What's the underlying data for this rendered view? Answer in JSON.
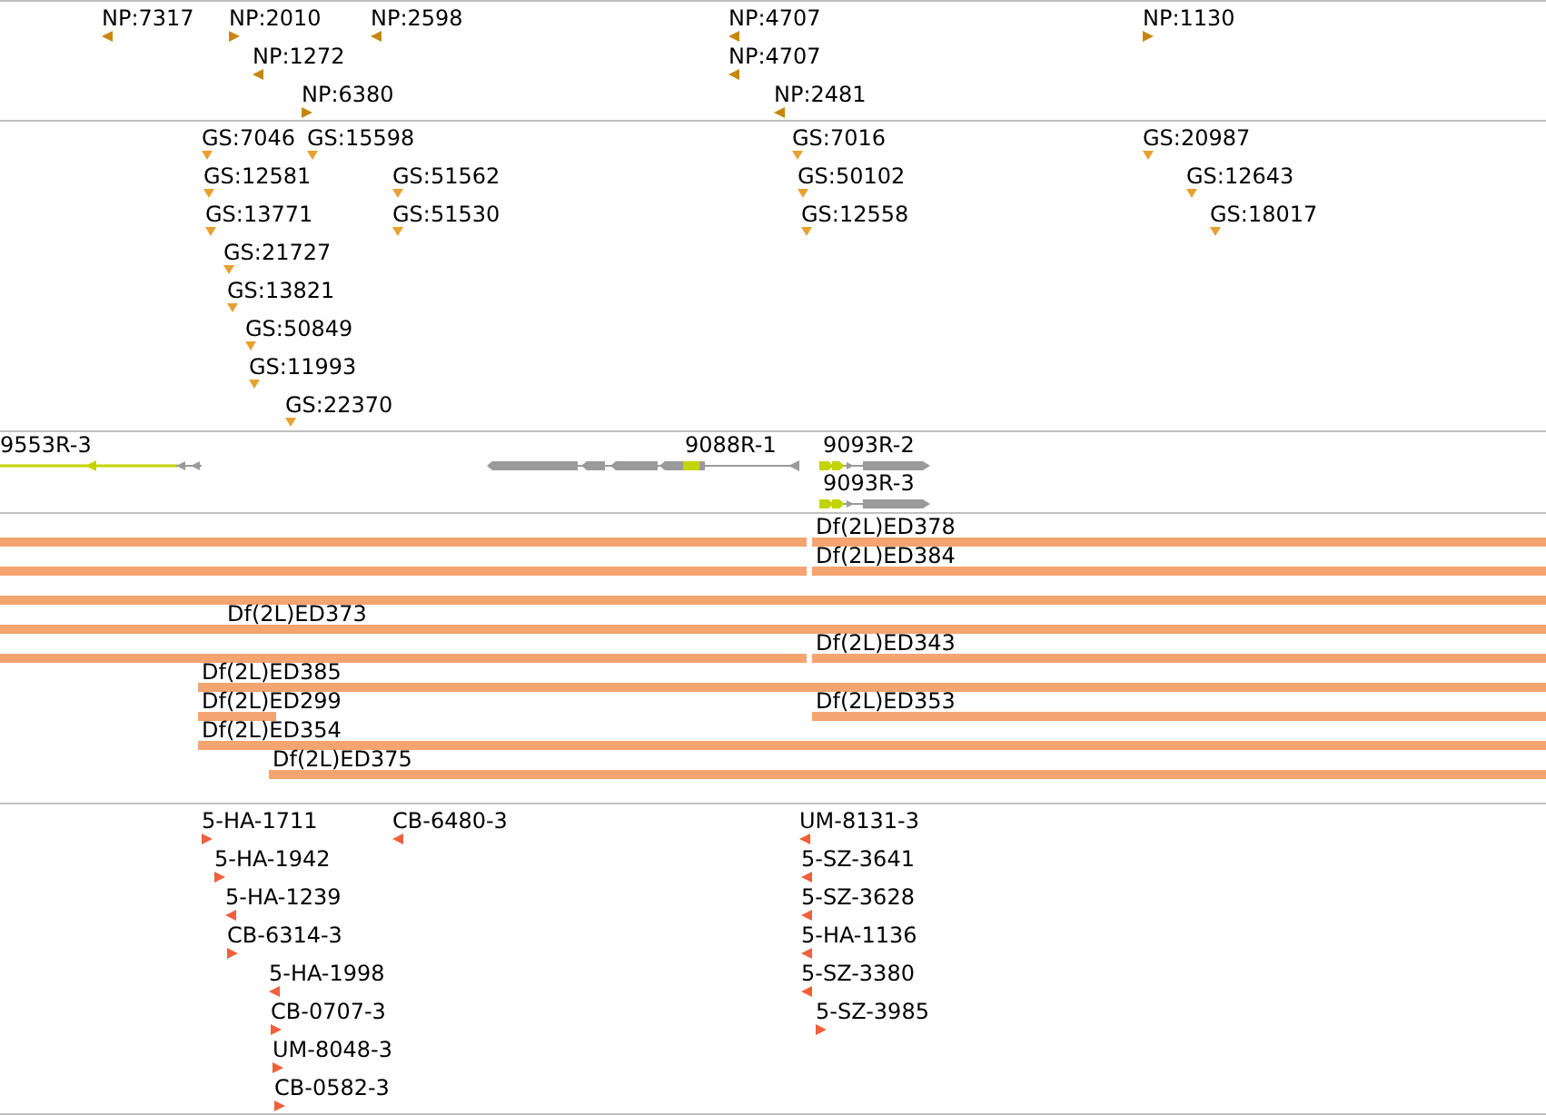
{
  "tracks": [
    {
      "kind": "flags",
      "color": "#c8860a",
      "features": [
        {
          "label": "NP:7317",
          "reverse": true
        },
        {
          "label": "NP:2010",
          "reverse": false
        },
        {
          "label": "NP:2598",
          "reverse": true
        },
        {
          "label": "NP:4707",
          "reverse": true
        },
        {
          "label": "NP:1130",
          "reverse": false
        },
        {
          "label": "NP:1272",
          "reverse": true
        },
        {
          "label": "NP:4707",
          "reverse": true
        },
        {
          "label": "NP:6380",
          "reverse": false
        },
        {
          "label": "NP:2481",
          "reverse": true
        }
      ]
    },
    {
      "kind": "drops",
      "color": "#e8a030",
      "features": [
        {
          "label": "GS:7046"
        },
        {
          "label": "GS:15598"
        },
        {
          "label": "GS:7016"
        },
        {
          "label": "GS:20987"
        },
        {
          "label": "GS:12581"
        },
        {
          "label": "GS:51562"
        },
        {
          "label": "GS:50102"
        },
        {
          "label": "GS:12643"
        },
        {
          "label": "GS:13771"
        },
        {
          "label": "GS:51530"
        },
        {
          "label": "GS:12558"
        },
        {
          "label": "GS:18017"
        },
        {
          "label": "GS:21727"
        },
        {
          "label": "GS:13821"
        },
        {
          "label": "GS:50849"
        },
        {
          "label": "GS:11993"
        },
        {
          "label": "GS:22370"
        }
      ]
    },
    {
      "kind": "genes",
      "features": [
        {
          "label": "9553R-3",
          "reverse": true
        },
        {
          "label": "9088R-1",
          "reverse": true
        },
        {
          "label": "9093R-2",
          "reverse": false
        },
        {
          "label": "9093R-3",
          "reverse": false
        }
      ]
    },
    {
      "kind": "bars",
      "color": "#f4a470",
      "rows": [
        {
          "bars": [
            {
              "kind": "plain"
            },
            {
              "kind": "labeled",
              "label": "Df(2L)ED378"
            }
          ]
        },
        {
          "bars": [
            {
              "kind": "plain"
            },
            {
              "kind": "labeled",
              "label": "Df(2L)ED384"
            }
          ]
        },
        {
          "bars": [
            {
              "kind": "plain"
            }
          ]
        },
        {
          "bars": [
            {
              "kind": "labeled",
              "label": "Df(2L)ED373"
            }
          ]
        },
        {
          "bars": [
            {
              "kind": "plain"
            },
            {
              "kind": "labeled",
              "label": "Df(2L)ED343"
            }
          ]
        },
        {
          "bars": [
            {
              "kind": "labeled",
              "label": "Df(2L)ED385"
            }
          ]
        },
        {
          "bars": [
            {
              "kind": "labeled",
              "label": "Df(2L)ED299"
            },
            {
              "kind": "labeled",
              "label": "Df(2L)ED353"
            }
          ]
        },
        {
          "bars": [
            {
              "kind": "labeled",
              "label": "Df(2L)ED354"
            }
          ]
        },
        {
          "bars": [
            {
              "kind": "labeled",
              "label": "Df(2L)ED375"
            }
          ]
        }
      ]
    },
    {
      "kind": "flags",
      "color": "#f0603a",
      "features": [
        {
          "label": "5-HA-1711",
          "reverse": false
        },
        {
          "label": "CB-6480-3",
          "reverse": true
        },
        {
          "label": "UM-8131-3",
          "reverse": true
        },
        {
          "label": "5-HA-1942",
          "reverse": false
        },
        {
          "label": "5-SZ-3641",
          "reverse": true
        },
        {
          "label": "5-HA-1239",
          "reverse": true
        },
        {
          "label": "5-SZ-3628",
          "reverse": true
        },
        {
          "label": "CB-6314-3",
          "reverse": false
        },
        {
          "label": "5-HA-1136",
          "reverse": true
        },
        {
          "label": "5-HA-1998",
          "reverse": true
        },
        {
          "label": "5-SZ-3380",
          "reverse": true
        },
        {
          "label": "CB-0707-3",
          "reverse": false
        },
        {
          "label": "5-SZ-3985",
          "reverse": false
        },
        {
          "label": "UM-8048-3",
          "reverse": false
        },
        {
          "label": "CB-0582-3",
          "reverse": false
        }
      ]
    }
  ]
}
